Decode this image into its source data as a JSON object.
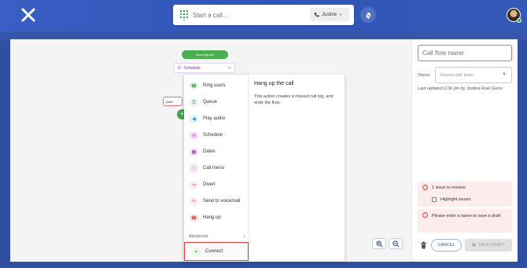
{
  "topbar": {
    "call_placeholder": "Start a call...",
    "caller_name": "Justine"
  },
  "canvas": {
    "incoming_call": "Incoming call",
    "schedule_node": "Schedule",
    "outer_node": "Oute"
  },
  "menu": {
    "items": [
      {
        "label": "Ring users",
        "icon": "ring-users-icon",
        "color": "#43a047",
        "bg": "#e8f5e9"
      },
      {
        "label": "Queue",
        "icon": "queue-icon",
        "color": "#43a047",
        "bg": "#e8f5e9"
      },
      {
        "label": "Play audio",
        "icon": "speaker-icon",
        "color": "#1e88e5",
        "bg": "#e3f2fd"
      },
      {
        "label": "Schedule",
        "icon": "clock-icon",
        "color": "#8e24aa",
        "bg": "#f3e5f5"
      },
      {
        "label": "Dates",
        "icon": "calendar-icon",
        "color": "#8e24aa",
        "bg": "#f3e5f5"
      },
      {
        "label": "Call menu",
        "icon": "dialpad-icon",
        "color": "#8e24aa",
        "bg": "#f3e5f5"
      },
      {
        "label": "Divert",
        "icon": "divert-icon",
        "color": "#e53935",
        "bg": "#fdecec"
      },
      {
        "label": "Send to voicemail",
        "icon": "voicemail-icon",
        "color": "#e53935",
        "bg": "#fdecec"
      },
      {
        "label": "Hang up",
        "icon": "hangup-icon",
        "color": "#e53935",
        "bg": "#fdecec"
      }
    ],
    "advanced_label": "Advanced",
    "connect_label": "Connect"
  },
  "detail": {
    "title": "Hang up the call",
    "description": "This action creates a missed call log, and ends the flow."
  },
  "right": {
    "name_placeholder": "Call flow name",
    "owner_label": "Owner",
    "owner_placeholder": "Shared with team",
    "last_updated": "Last updated 2.06 pm by Justine Roel Gorre",
    "issue_count": "1 issue to resolve",
    "highlight_label": "Highlight issues",
    "name_error": "Please enter a name to save a draft",
    "cancel_label": "CANCEL",
    "save_label": "SAVE DRAFT"
  }
}
